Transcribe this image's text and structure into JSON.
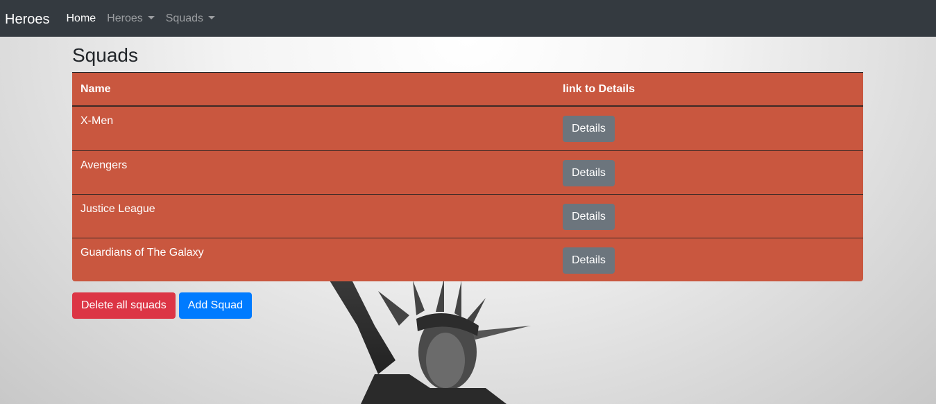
{
  "navbar": {
    "brand": "Heroes",
    "links": [
      {
        "label": "Home",
        "active": true,
        "dropdown": false
      },
      {
        "label": "Heroes",
        "active": false,
        "dropdown": true
      },
      {
        "label": "Squads",
        "active": false,
        "dropdown": true
      }
    ]
  },
  "page": {
    "title": "Squads"
  },
  "table": {
    "headers": [
      "Name",
      "link to Details"
    ],
    "rows": [
      {
        "name": "X-Men",
        "button": "Details"
      },
      {
        "name": "Avengers",
        "button": "Details"
      },
      {
        "name": "Justice League",
        "button": "Details"
      },
      {
        "name": "Guardians of The Galaxy",
        "button": "Details"
      }
    ]
  },
  "actions": {
    "delete_label": "Delete all squads",
    "add_label": "Add Squad"
  },
  "colors": {
    "navbar": "#343a40",
    "table_bg": "#c9573f",
    "details_button": "#6c757d",
    "danger": "#dc3545",
    "primary": "#007bff"
  }
}
